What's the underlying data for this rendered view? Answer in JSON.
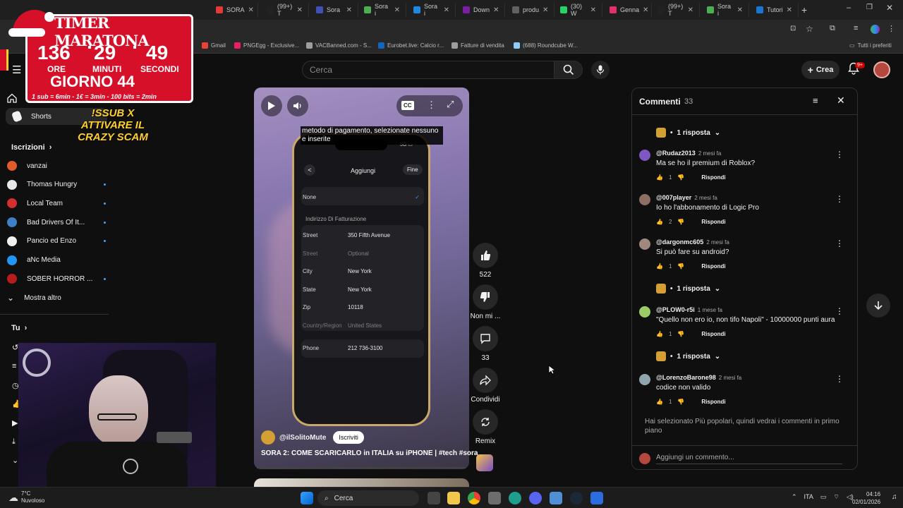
{
  "browser": {
    "tabs": [
      {
        "label": "SORA",
        "color": "#e53935"
      },
      {
        "label": "(99+) T",
        "color": "#222222"
      },
      {
        "label": "Sora",
        "color": "#3f51b5"
      },
      {
        "label": "Sora i",
        "color": "#4caf50"
      },
      {
        "label": "Sora i",
        "color": "#1e88e5"
      },
      {
        "label": "Down",
        "color": "#7b1fa2"
      },
      {
        "label": "produ",
        "color": "#616161"
      },
      {
        "label": "(30) W",
        "color": "#25d366"
      },
      {
        "label": "Genna",
        "color": "#e1306c"
      },
      {
        "label": "(99+) T",
        "color": "#222222"
      },
      {
        "label": "Sora i",
        "color": "#4caf50"
      },
      {
        "label": "Tutori",
        "color": "#1976d2"
      }
    ],
    "bookmarks": [
      {
        "label": "Gmail",
        "color": "#ea4335"
      },
      {
        "label": "PNGEgg - Exclusive...",
        "color": "#e91e63"
      },
      {
        "label": "VACBanned.com - S...",
        "color": "#9e9e9e"
      },
      {
        "label": "Eurobet.live: Calcio r...",
        "color": "#1565c0"
      },
      {
        "label": "Fatture di vendita",
        "color": "#9e9e9e"
      },
      {
        "label": "(688) Roundcube W...",
        "color": "#90caf9"
      }
    ],
    "bookmarks_all": "Tutti i preferiti"
  },
  "overlay": {
    "title": "TIMER MARATONA",
    "hours": "136",
    "minutes": "29",
    "seconds": "49",
    "hours_label": "ORE",
    "minutes_label": "MINUTI",
    "seconds_label": "SECONDI",
    "day": "GIORNO 44",
    "rules": "1 sub = 6min - 1€ = 3min - 100 bits = 2min",
    "sub_message": "!SSUB X ATTIVARE IL CRAZY SCAM"
  },
  "header": {
    "search_placeholder": "Cerca",
    "create_label": "Crea",
    "notif_badge": "9+"
  },
  "sidebar": {
    "shorts": "Shorts",
    "subscriptions_header": "Iscrizioni",
    "channels": [
      {
        "name": "vanzai",
        "color": "#e25b2b",
        "new": false
      },
      {
        "name": "Thomas Hungry",
        "color": "#e8e8e8",
        "new": true
      },
      {
        "name": "Local Team",
        "color": "#d32f2f",
        "new": true
      },
      {
        "name": "Bad Drivers Of It...",
        "color": "#3f7fc4",
        "new": true
      },
      {
        "name": "Pancio ed Enzo",
        "color": "#f0f0f0",
        "new": true
      },
      {
        "name": "aNc Media",
        "color": "#2196f3",
        "new": false
      },
      {
        "name": "SOBER HORROR ...",
        "color": "#b71c1c",
        "new": true
      }
    ],
    "show_more": "Mostra altro",
    "you": "Tu"
  },
  "video": {
    "caption": "metodo di pagamento, selezionate nessuno e inserite",
    "phone": {
      "back": "<",
      "title": "Aggiungi",
      "done": "Fine",
      "none_option": "None",
      "billing_header": "Indirizzo Di Fatturazione",
      "fields": [
        {
          "key": "Street",
          "value": "350 Fifth Avenue"
        },
        {
          "key": "Street",
          "value": "Optional"
        },
        {
          "key": "City",
          "value": "New York"
        },
        {
          "key": "State",
          "value": "New York"
        },
        {
          "key": "Zip",
          "value": "10118"
        },
        {
          "key": "Country/Region",
          "value": "United States"
        }
      ],
      "phone_key": "Phone",
      "phone_value": "212   736-3100"
    },
    "channel": "@ilSolitoMute",
    "subscribe": "Iscriviti",
    "title": "SORA 2: COME SCARICARLO in ITALIA su iPHONE | #tech #sora",
    "likes": "522",
    "dislike_label": "Non mi ...",
    "comments_count": "33",
    "share_label": "Condividi",
    "remix_label": "Remix"
  },
  "comments": {
    "title": "Commenti",
    "count": "33",
    "reply_label": "Rispondi",
    "replies_label": "1 risposta",
    "items": [
      {
        "author": "@Rudaz2013",
        "time": "2 mesi fa",
        "text": "Ma se ho il premium di Roblox?",
        "likes": "1",
        "color": "#7e57c2"
      },
      {
        "author": "@007player",
        "time": "2 mesi fa",
        "text": "Io ho l'abbonamento di Logic Pro",
        "likes": "2",
        "color": "#8d6e63"
      },
      {
        "author": "@dargonmc605",
        "time": "2 mesi fa",
        "text": "Si può fare su android?",
        "likes": "1",
        "color": "#a1887f"
      },
      {
        "author": "@PLOW0-r5i",
        "time": "1 mese fa",
        "text": "\"Quello non ero io, non tifo Napoli\" - 10000000 punti aura",
        "likes": "1",
        "color": "#9ccc65"
      },
      {
        "author": "@LorenzoBarone98",
        "time": "2 mesi fa",
        "text": "codice non valido",
        "likes": "1",
        "color": "#90a4ae"
      }
    ],
    "footer_note": "Hai selezionato Più popolari, quindi vedrai i commenti in primo piano",
    "add_placeholder": "Aggiungi un commento..."
  },
  "taskbar": {
    "temp": "7°C",
    "weather": "Nuvoloso",
    "search": "Cerca",
    "lang": "ITA",
    "time": "04:16",
    "date": "02/01/2026"
  }
}
